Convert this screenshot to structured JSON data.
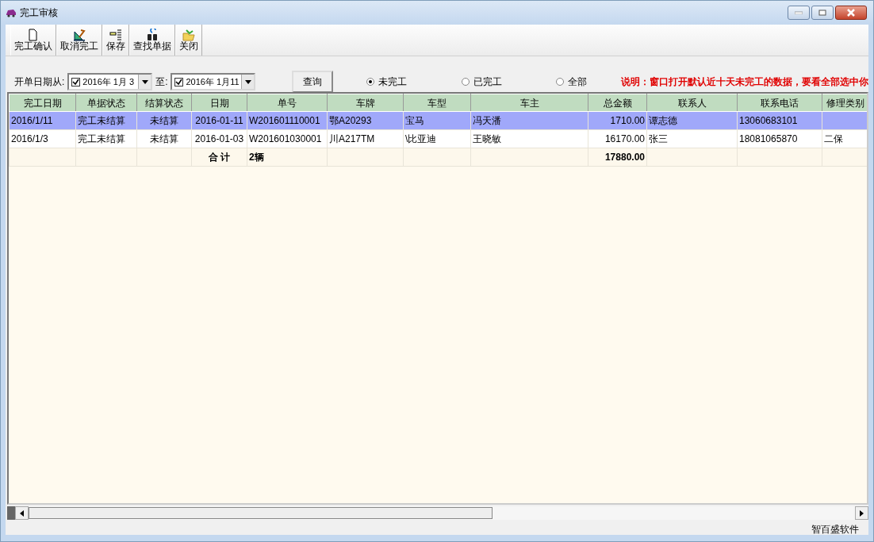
{
  "window": {
    "title": "完工审核"
  },
  "toolbar": [
    {
      "kind": "page",
      "label": "完工确认"
    },
    {
      "kind": "ruler",
      "label": "取消完工"
    },
    {
      "kind": "list",
      "label": "保存"
    },
    {
      "kind": "binoculars",
      "label": "查找单据"
    },
    {
      "kind": "folder",
      "label": "关闭"
    }
  ],
  "filter": {
    "from_label": "开单日期从:",
    "from": {
      "checked": true,
      "value": "2016年 1月 3"
    },
    "to_label": "至:",
    "to": {
      "checked": true,
      "value": "2016年 1月11"
    },
    "query_button": "查询",
    "radios": [
      {
        "label": "未完工",
        "selected": true
      },
      {
        "label": "已完工",
        "selected": false
      },
      {
        "label": "全部",
        "selected": false
      }
    ],
    "note": "说明：窗口打开默认近十天未完工的数据，要看全部选中你"
  },
  "table": {
    "columns": [
      "完工日期",
      "单据状态",
      "结算状态",
      "日期",
      "单号",
      "车牌",
      "车型",
      "车主",
      "总金额",
      "联系人",
      "联系电话",
      "修理类别"
    ],
    "rows": [
      {
        "selected": true,
        "cells": [
          "2016/1/11",
          "完工未结算",
          "未结算",
          "2016-01-11",
          "W201601110001",
          "鄂A20293",
          "宝马",
          "冯天潘",
          "1710.00",
          "谭志德",
          "13060683101",
          ""
        ]
      },
      {
        "selected": false,
        "cells": [
          "2016/1/3",
          "完工未结算",
          "未结算",
          "2016-01-03",
          "W201601030001",
          "川A217TM",
          "\\比亚迪",
          "王晓敏",
          "16170.00",
          "张三",
          "18081065870",
          "二保"
        ]
      }
    ],
    "total": {
      "label": "合 计",
      "count": "2辆",
      "amount": "17880.00"
    }
  },
  "status_bar": "智百盛软件"
}
